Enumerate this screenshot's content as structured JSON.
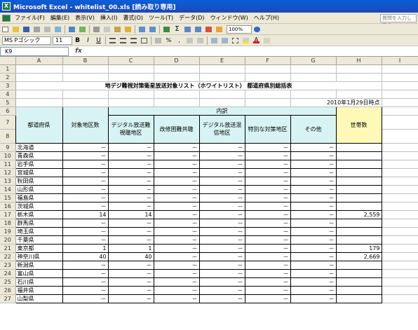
{
  "window": {
    "title": "Microsoft Excel - whitelist_00.xls [読み取り専用]"
  },
  "menu": {
    "items": [
      "ファイル(F)",
      "編集(E)",
      "表示(V)",
      "挿入(I)",
      "書式(O)",
      "ツール(T)",
      "データ(D)",
      "ウィンドウ(W)",
      "ヘルプ(H)"
    ],
    "help_placeholder": "質問を入力してく"
  },
  "toolbar": {
    "zoom": "100%",
    "font": "MS Pゴシック",
    "size": "11",
    "bold": "B",
    "italic": "I",
    "underline": "U"
  },
  "formula": {
    "cell_ref": "K9",
    "fx": "fx"
  },
  "sheet": {
    "columns": [
      "A",
      "B",
      "C",
      "D",
      "E",
      "F",
      "G",
      "H",
      "I"
    ],
    "title": "地デジ難視対策衛星放送対象リスト（ホワイトリスト） 都道府県別総括表",
    "date": "2010年1月29日時点",
    "header": {
      "prefecture": "都道府県",
      "target_area": "対象地区数",
      "breakdown": "内訳",
      "digital_difficult": "デジタル放送難視聴地区",
      "improvement": "改修困難共聴",
      "interference": "デジタル放送混信地区",
      "special": "特別な対策地区",
      "other": "その他",
      "households": "世帯数"
    },
    "rows": [
      {
        "num": "9",
        "pref": "北海道",
        "b": "－",
        "c": "－",
        "d": "－",
        "e": "－",
        "f": "－",
        "g": "－",
        "h": ""
      },
      {
        "num": "10",
        "pref": "青森県",
        "b": "－",
        "c": "－",
        "d": "－",
        "e": "－",
        "f": "－",
        "g": "－",
        "h": ""
      },
      {
        "num": "11",
        "pref": "岩手県",
        "b": "－",
        "c": "－",
        "d": "－",
        "e": "－",
        "f": "－",
        "g": "－",
        "h": ""
      },
      {
        "num": "12",
        "pref": "宮城県",
        "b": "－",
        "c": "－",
        "d": "－",
        "e": "－",
        "f": "－",
        "g": "－",
        "h": ""
      },
      {
        "num": "13",
        "pref": "秋田県",
        "b": "－",
        "c": "－",
        "d": "－",
        "e": "－",
        "f": "－",
        "g": "－",
        "h": ""
      },
      {
        "num": "14",
        "pref": "山形県",
        "b": "－",
        "c": "－",
        "d": "－",
        "e": "－",
        "f": "－",
        "g": "－",
        "h": ""
      },
      {
        "num": "15",
        "pref": "福島県",
        "b": "－",
        "c": "－",
        "d": "－",
        "e": "－",
        "f": "－",
        "g": "－",
        "h": ""
      },
      {
        "num": "16",
        "pref": "茨城県",
        "b": "－",
        "c": "－",
        "d": "－",
        "e": "－",
        "f": "－",
        "g": "－",
        "h": ""
      },
      {
        "num": "17",
        "pref": "栃木県",
        "b": "14",
        "c": "14",
        "d": "－",
        "e": "－",
        "f": "－",
        "g": "－",
        "h": "2,559"
      },
      {
        "num": "18",
        "pref": "群馬県",
        "b": "－",
        "c": "－",
        "d": "－",
        "e": "－",
        "f": "－",
        "g": "－",
        "h": ""
      },
      {
        "num": "19",
        "pref": "埼玉県",
        "b": "－",
        "c": "－",
        "d": "－",
        "e": "－",
        "f": "－",
        "g": "－",
        "h": ""
      },
      {
        "num": "20",
        "pref": "千葉県",
        "b": "－",
        "c": "－",
        "d": "－",
        "e": "－",
        "f": "－",
        "g": "－",
        "h": ""
      },
      {
        "num": "21",
        "pref": "東京都",
        "b": "1",
        "c": "1",
        "d": "－",
        "e": "－",
        "f": "－",
        "g": "－",
        "h": "179"
      },
      {
        "num": "22",
        "pref": "神奈川県",
        "b": "40",
        "c": "40",
        "d": "－",
        "e": "－",
        "f": "－",
        "g": "－",
        "h": "2,669"
      },
      {
        "num": "23",
        "pref": "新潟県",
        "b": "－",
        "c": "－",
        "d": "－",
        "e": "－",
        "f": "－",
        "g": "－",
        "h": ""
      },
      {
        "num": "24",
        "pref": "富山県",
        "b": "－",
        "c": "－",
        "d": "－",
        "e": "－",
        "f": "－",
        "g": "－",
        "h": ""
      },
      {
        "num": "25",
        "pref": "石川県",
        "b": "－",
        "c": "－",
        "d": "－",
        "e": "－",
        "f": "－",
        "g": "－",
        "h": ""
      },
      {
        "num": "26",
        "pref": "福井県",
        "b": "－",
        "c": "－",
        "d": "－",
        "e": "－",
        "f": "－",
        "g": "－",
        "h": ""
      },
      {
        "num": "27",
        "pref": "山梨県",
        "b": "－",
        "c": "－",
        "d": "－",
        "e": "－",
        "f": "－",
        "g": "－",
        "h": ""
      }
    ]
  }
}
